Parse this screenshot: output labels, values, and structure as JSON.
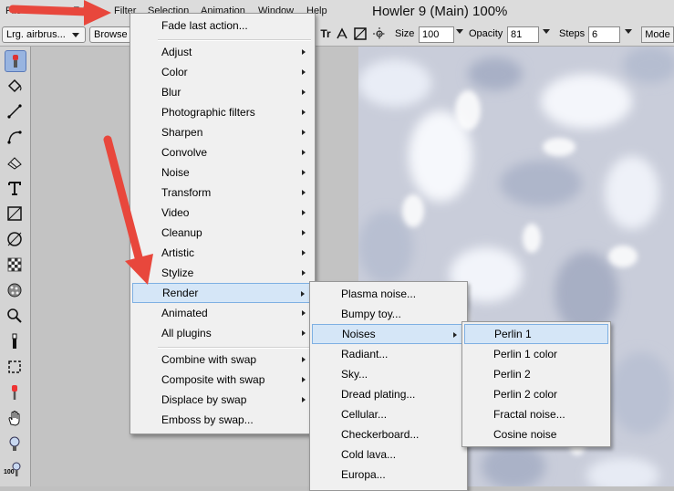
{
  "menubar": {
    "items": [
      "File",
      "Edit",
      "Filter",
      "Selection",
      "Animation",
      "Window",
      "Help"
    ],
    "app_title": "Howler 9  (Main)   100%"
  },
  "toolbar": {
    "brush_select": "Lrg. airbrus...",
    "browse_button": "Browse",
    "size_label": "Size",
    "size_value": "100",
    "opacity_label": "Opacity",
    "opacity_value": "81",
    "steps_label": "Steps",
    "steps_value": "6",
    "mode_button": "Mode",
    "tr_label": "Tr"
  },
  "filter_menu": {
    "fade_last": "Fade last action...",
    "items": [
      "Adjust",
      "Color",
      "Blur",
      "Photographic filters",
      "Sharpen",
      "Convolve",
      "Noise",
      "Transform",
      "Video",
      "Cleanup",
      "Artistic",
      "Stylize",
      "Render",
      "Animated",
      "All plugins"
    ],
    "swap_items": [
      "Combine with swap",
      "Composite with swap",
      "Displace by swap",
      "Emboss by swap..."
    ]
  },
  "render_menu": {
    "items": [
      "Plasma noise...",
      "Bumpy toy...",
      "Noises",
      "Radiant...",
      "Sky...",
      "Dread plating...",
      "Cellular...",
      "Checkerboard...",
      "Cold lava...",
      "Europa..."
    ]
  },
  "noises_menu": {
    "items": [
      "Perlin 1",
      "Perlin 1 color",
      "Perlin 2",
      "Perlin 2 color",
      "Fractal noise...",
      "Cosine noise"
    ]
  },
  "toolbox": {
    "zoom_label": "100"
  },
  "colors": {
    "menu_bg": "#f0f0f0",
    "highlight_bg": "#d5e6f7",
    "highlight_border": "#7eb0e3",
    "arrow_red": "#e8473c"
  }
}
